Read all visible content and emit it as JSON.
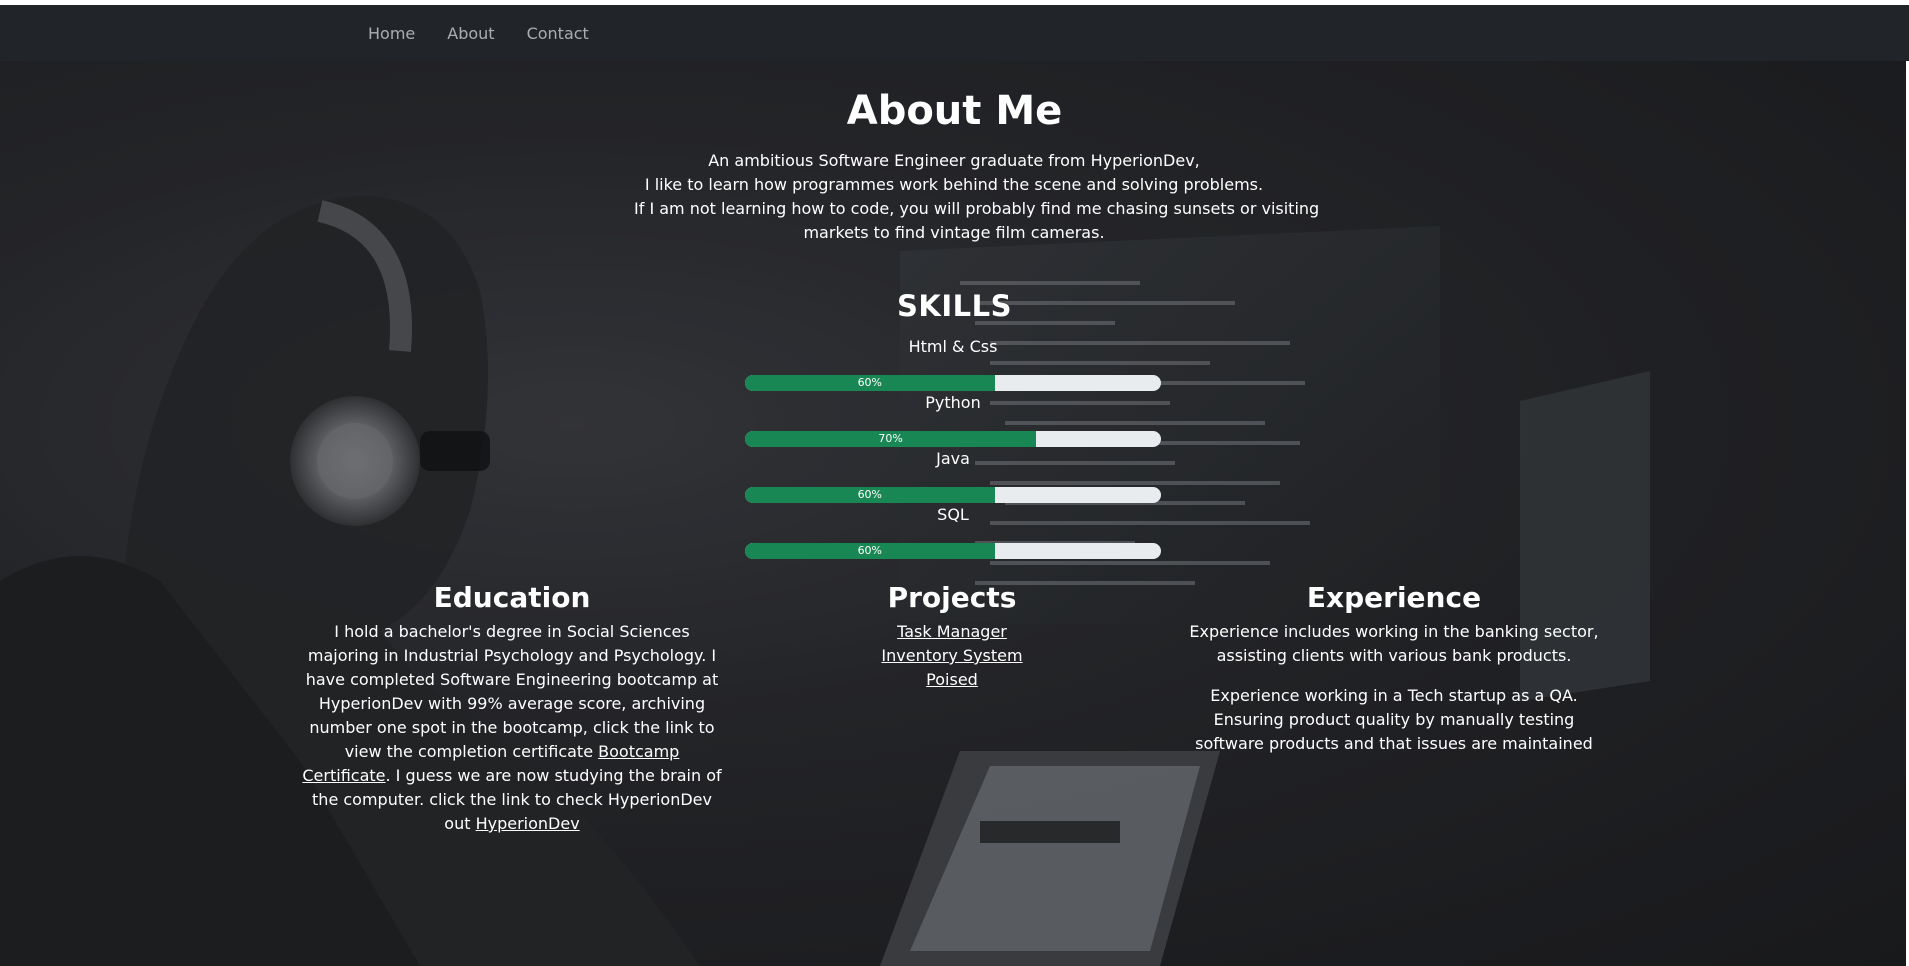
{
  "nav": {
    "items": [
      "Home",
      "About",
      "Contact"
    ]
  },
  "about": {
    "title": "About Me",
    "intro_lines": [
      "An ambitious Software Engineer graduate from HyperionDev,",
      "I like to learn how programmes work behind the scene and solving problems.",
      "If I am not learning how to code, you will probably find me chasing sunsets or visiting",
      "markets to find vintage film cameras."
    ]
  },
  "skills": {
    "title": "SKILLS",
    "items": [
      {
        "name": "Html & Css",
        "percent": 60,
        "label": "60%"
      },
      {
        "name": "Python",
        "percent": 70,
        "label": "70%"
      },
      {
        "name": "Java",
        "percent": 60,
        "label": "60%"
      },
      {
        "name": "SQL",
        "percent": 60,
        "label": "60%"
      }
    ]
  },
  "education": {
    "title": "Education",
    "text_1": "I hold a bachelor's degree in Social Sciences majoring in Industrial Psychology and Psychology. I have completed Software Engineering bootcamp at HyperionDev with 99% average score, archiving number one spot in the bootcamp, click the link to view the completion certificate ",
    "link_1": "Bootcamp Certificate",
    "text_2": ". I guess we are now studying the brain of the computer. click the link to check HyperionDev out ",
    "link_2": "HyperionDev"
  },
  "projects": {
    "title": "Projects",
    "links": [
      "Task Manager",
      "Inventory System",
      "Poised"
    ]
  },
  "experience": {
    "title": "Experience",
    "paragraph_1": "Experience includes working in the banking sector, assisting clients with various bank products.",
    "paragraph_2": "Experience working in a Tech startup as a QA. Ensuring product quality by manually testing software products and that issues are maintained"
  },
  "colors": {
    "navbar": "#212529",
    "progress_fill": "#198754",
    "progress_track": "#e9ecef"
  }
}
